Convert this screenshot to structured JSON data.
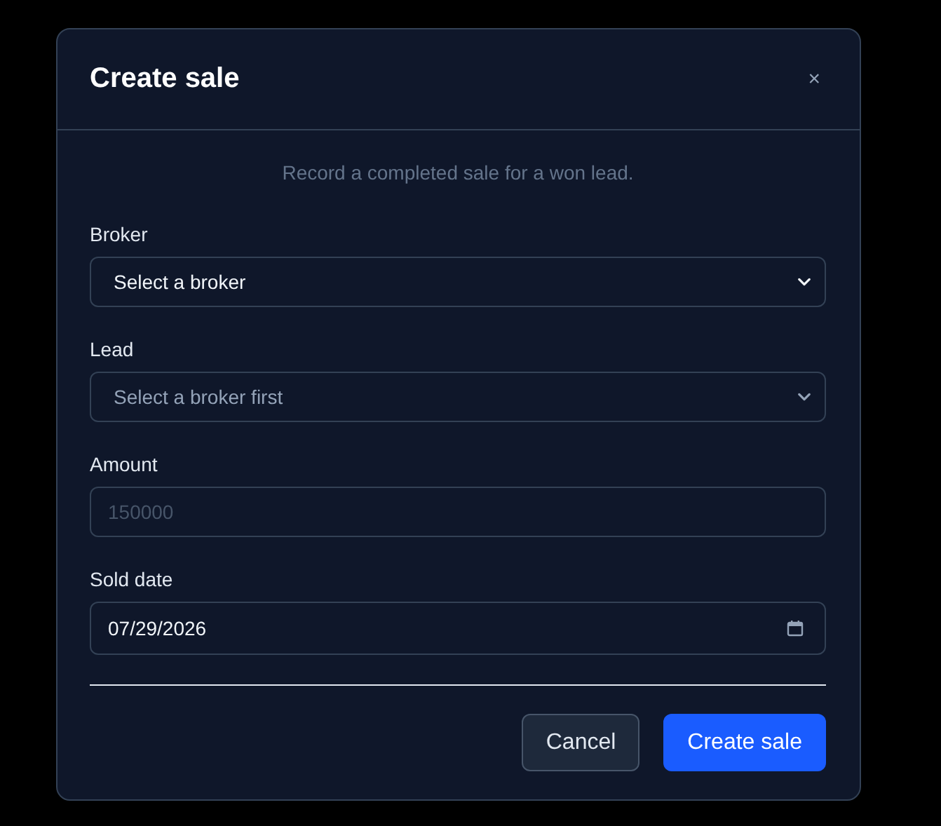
{
  "dialog": {
    "title": "Create sale",
    "close": "×",
    "description": "Record a completed sale for a won lead.",
    "fields": [
      {
        "kind": "select",
        "label": "Broker",
        "value": "Select a broker",
        "disabled": false
      },
      {
        "kind": "select",
        "label": "Lead",
        "value": "Select a broker first",
        "disabled": true
      },
      {
        "kind": "text",
        "label": "Amount",
        "placeholder": "150000"
      },
      {
        "kind": "date",
        "label": "Sold date",
        "value": "07/29/2026"
      }
    ],
    "buttons": [
      {
        "label": "Cancel",
        "kind": "secondary"
      },
      {
        "label": "Create sale",
        "kind": "primary"
      }
    ]
  }
}
